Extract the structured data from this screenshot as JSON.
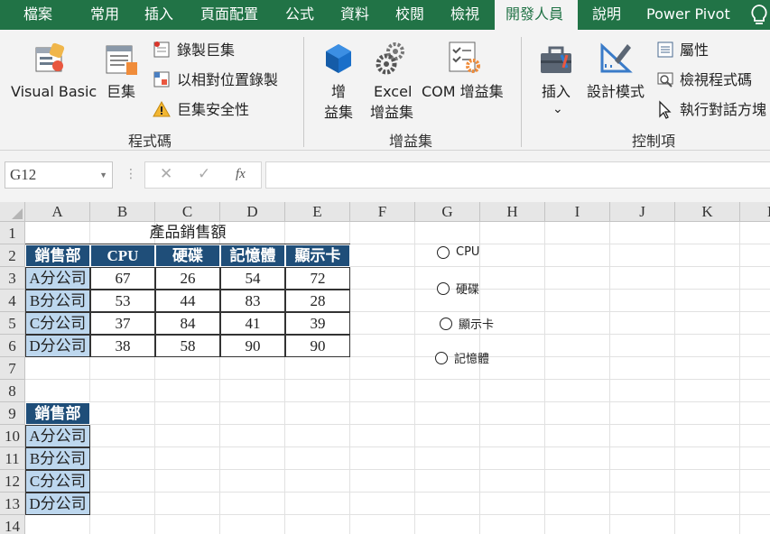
{
  "tabs": [
    "檔案",
    "常用",
    "插入",
    "頁面配置",
    "公式",
    "資料",
    "校閱",
    "檢視",
    "開發人員",
    "說明",
    "Power Pivot"
  ],
  "active_tab": "開發人員",
  "ribbon": {
    "code_group": {
      "visual_basic": "Visual Basic",
      "macros": "巨集",
      "record_macro": "錄製巨集",
      "relative_ref": "以相對位置錄製",
      "macro_security": "巨集安全性",
      "label": "程式碼"
    },
    "addins_group": {
      "addins_line1": "增",
      "addins_line2": "益集",
      "excel_addins_line1": "Excel",
      "excel_addins_line2": "增益集",
      "com_addins": "COM 增益集",
      "label": "增益集"
    },
    "controls_group": {
      "insert": "插入",
      "insert_arrow": "⌄",
      "design_mode": "設計模式",
      "properties": "屬性",
      "view_code": "檢視程式碼",
      "run_dialog": "執行對話方塊",
      "label": "控制項"
    }
  },
  "formula_bar": {
    "name_box": "G12",
    "name_dropdown": "▼",
    "dots": "⋮",
    "cancel": "✕",
    "enter": "✓",
    "fx": "fx",
    "formula": ""
  },
  "sheet": {
    "columns": [
      "A",
      "B",
      "C",
      "D",
      "E",
      "F",
      "G",
      "H",
      "I",
      "J",
      "K",
      "L"
    ],
    "rows": [
      "1",
      "2",
      "3",
      "4",
      "5",
      "6",
      "7",
      "8",
      "9",
      "10",
      "11",
      "12",
      "13",
      "14"
    ],
    "table_title": "產品銷售額",
    "headers": [
      "銷售部",
      "CPU",
      "硬碟",
      "記憶體",
      "顯示卡"
    ],
    "data": [
      [
        "A分公司",
        "67",
        "26",
        "54",
        "72"
      ],
      [
        "B分公司",
        "53",
        "44",
        "83",
        "28"
      ],
      [
        "C分公司",
        "37",
        "84",
        "41",
        "39"
      ],
      [
        "D分公司",
        "38",
        "58",
        "90",
        "90"
      ]
    ],
    "second_header": "銷售部",
    "second_rows": [
      "A分公司",
      "B分公司",
      "C分公司",
      "D分公司"
    ]
  },
  "option_buttons": [
    "CPU",
    "硬碟",
    "顯示卡",
    "記憶體"
  ],
  "colors": {
    "ribbon_green": "#217346",
    "header_blue": "#1f4e79",
    "row_light_blue": "#bdd7ee"
  },
  "icons": {
    "visual_basic": "visual-basic-icon",
    "macros": "macros-icon",
    "record_macro": "record-macro-icon",
    "relative_ref": "relative-reference-icon",
    "macro_security": "warning-icon",
    "addins": "addins-cube-icon",
    "excel_addins": "gears-icon",
    "com_addins": "com-addins-icon",
    "insert": "toolbox-icon",
    "design_mode": "design-mode-icon",
    "properties": "properties-icon",
    "view_code": "view-code-icon",
    "run_dialog": "run-dialog-icon",
    "help": "lightbulb-icon"
  }
}
